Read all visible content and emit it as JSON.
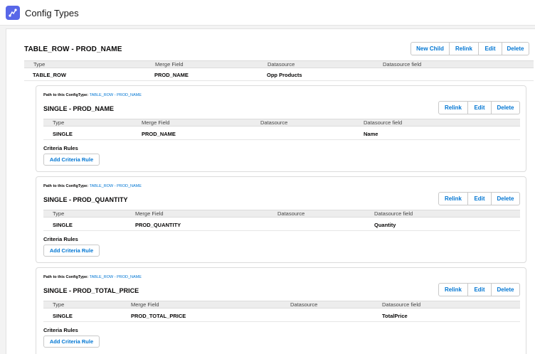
{
  "app": {
    "title": "Config Types"
  },
  "parent": {
    "title": "TABLE_ROW - PROD_NAME",
    "buttons": [
      "New Child",
      "Relink",
      "Edit",
      "Delete"
    ],
    "columns": [
      "Type",
      "Merge Field",
      "Datasource",
      "Datasource field"
    ],
    "row": [
      "TABLE_ROW",
      "PROD_NAME",
      "Opp Products",
      ""
    ]
  },
  "children": [
    {
      "path_label": "Path to this ConfigType:",
      "path_link": "TABLE_ROW - PROD_NAME",
      "title": "SINGLE - PROD_NAME",
      "buttons": [
        "Relink",
        "Edit",
        "Delete"
      ],
      "columns": [
        "Type",
        "Merge Field",
        "Datasource",
        "Datasource field"
      ],
      "row": [
        "SINGLE",
        "PROD_NAME",
        "",
        "Name"
      ],
      "criteria_label": "Criteria Rules",
      "add_label": "Add Criteria Rule"
    },
    {
      "path_label": "Path to this ConfigType:",
      "path_link": "TABLE_ROW - PROD_NAME",
      "title": "SINGLE - PROD_QUANTITY",
      "buttons": [
        "Relink",
        "Edit",
        "Delete"
      ],
      "columns": [
        "Type",
        "Merge Field",
        "Datasource",
        "Datasource field"
      ],
      "row": [
        "SINGLE",
        "PROD_QUANTITY",
        "",
        "Quantity"
      ],
      "criteria_label": "Criteria Rules",
      "add_label": "Add Criteria Rule"
    },
    {
      "path_label": "Path to this ConfigType:",
      "path_link": "TABLE_ROW - PROD_NAME",
      "title": "SINGLE - PROD_TOTAL_PRICE",
      "buttons": [
        "Relink",
        "Edit",
        "Delete"
      ],
      "columns": [
        "Type",
        "Merge Field",
        "Datasource",
        "Datasource field"
      ],
      "row": [
        "SINGLE",
        "PROD_TOTAL_PRICE",
        "",
        "TotalPrice"
      ],
      "criteria_label": "Criteria Rules",
      "add_label": "Add Criteria Rule"
    }
  ],
  "colors": {
    "accent": "#0176d3",
    "app_icon": "#5867e8"
  },
  "icons": {
    "app": "app-switcher-icon"
  }
}
